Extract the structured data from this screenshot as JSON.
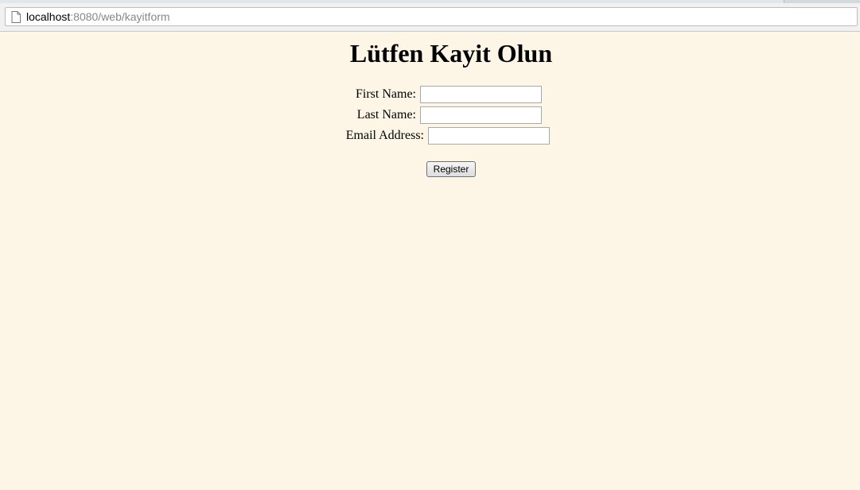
{
  "browser": {
    "url_host": "localhost",
    "url_rest": ":8080/web/kayitform"
  },
  "form": {
    "title": "Lütfen Kayit Olun",
    "first_name_label": "First Name:",
    "first_name_value": "",
    "last_name_label": "Last Name:",
    "last_name_value": "",
    "email_label": "Email Address:",
    "email_value": "",
    "submit_label": "Register"
  },
  "colors": {
    "page_background": "#fdf5e6",
    "toolbar_background": "#f1f1f1"
  },
  "icons": {
    "page": "page-icon"
  }
}
